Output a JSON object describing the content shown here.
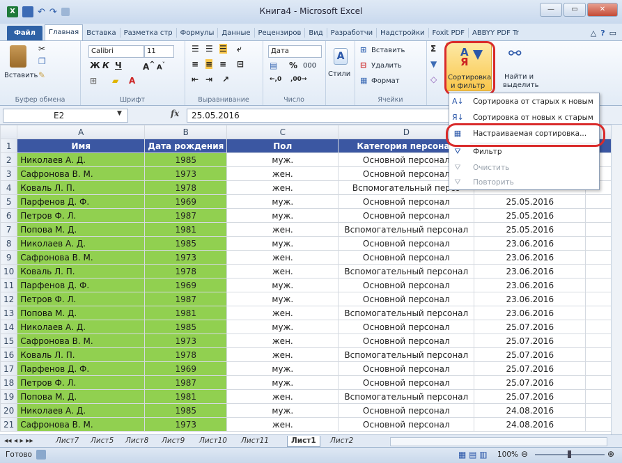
{
  "window": {
    "title": "Книга4 - Microsoft Excel"
  },
  "tabs": [
    "Файл",
    "Главная",
    "Вставка",
    "Разметка стр",
    "Формулы",
    "Данные",
    "Рецензиров",
    "Вид",
    "Разработчи",
    "Надстройки",
    "Foxit PDF",
    "ABBYY PDF Tr"
  ],
  "ribbon": {
    "paste": "Вставить",
    "clipboard_group": "Буфер обмена",
    "font_name": "Calibri",
    "font_size": "11",
    "bold": "Ж",
    "italic": "К",
    "underline": "Ч",
    "font_group": "Шрифт",
    "align_group": "Выравнивание",
    "number_format": "Дата",
    "percent": "%",
    "thousands": "000",
    "number_group": "Число",
    "styles": "Стили",
    "insert": "Вставить",
    "delete": "Удалить",
    "format": "Формат",
    "cells_group": "Ячейки",
    "sort_filter_line1": "Сортировка",
    "sort_filter_line2": "и фильтр",
    "find_line1": "Найти и",
    "find_line2": "выделить"
  },
  "formula_bar": {
    "name_box": "E2",
    "fx": "fx",
    "formula": "25.05.2016"
  },
  "columns": [
    "A",
    "B",
    "C",
    "D"
  ],
  "header_row": {
    "name": "Имя",
    "date": "Дата рождения",
    "sex": "Пол",
    "category": "Категория персонал"
  },
  "rows": [
    {
      "n": "2",
      "name": "Николаев А. Д.",
      "year": "1985",
      "sex": "муж.",
      "cat": "Основной персонал",
      "date": ""
    },
    {
      "n": "3",
      "name": "Сафронова В. М.",
      "year": "1973",
      "sex": "жен.",
      "cat": "Основной персонал",
      "date": ""
    },
    {
      "n": "4",
      "name": "Коваль Л. П.",
      "year": "1978",
      "sex": "жен.",
      "cat": "Вспомогательный персо",
      "date": ""
    },
    {
      "n": "5",
      "name": "Парфенов Д. Ф.",
      "year": "1969",
      "sex": "муж.",
      "cat": "Основной персонал",
      "date": "25.05.2016"
    },
    {
      "n": "6",
      "name": "Петров Ф. Л.",
      "year": "1987",
      "sex": "муж.",
      "cat": "Основной персонал",
      "date": "25.05.2016"
    },
    {
      "n": "7",
      "name": "Попова М. Д.",
      "year": "1981",
      "sex": "жен.",
      "cat": "Вспомогательный персонал",
      "date": "25.05.2016"
    },
    {
      "n": "8",
      "name": "Николаев А. Д.",
      "year": "1985",
      "sex": "муж.",
      "cat": "Основной персонал",
      "date": "23.06.2016"
    },
    {
      "n": "9",
      "name": "Сафронова В. М.",
      "year": "1973",
      "sex": "жен.",
      "cat": "Основной персонал",
      "date": "23.06.2016"
    },
    {
      "n": "10",
      "name": "Коваль Л. П.",
      "year": "1978",
      "sex": "жен.",
      "cat": "Вспомогательный персонал",
      "date": "23.06.2016"
    },
    {
      "n": "11",
      "name": "Парфенов Д. Ф.",
      "year": "1969",
      "sex": "муж.",
      "cat": "Основной персонал",
      "date": "23.06.2016"
    },
    {
      "n": "12",
      "name": "Петров Ф. Л.",
      "year": "1987",
      "sex": "муж.",
      "cat": "Основной персонал",
      "date": "23.06.2016"
    },
    {
      "n": "13",
      "name": "Попова М. Д.",
      "year": "1981",
      "sex": "жен.",
      "cat": "Вспомогательный персонал",
      "date": "23.06.2016"
    },
    {
      "n": "14",
      "name": "Николаев А. Д.",
      "year": "1985",
      "sex": "муж.",
      "cat": "Основной персонал",
      "date": "25.07.2016"
    },
    {
      "n": "15",
      "name": "Сафронова В. М.",
      "year": "1973",
      "sex": "жен.",
      "cat": "Основной персонал",
      "date": "25.07.2016"
    },
    {
      "n": "16",
      "name": "Коваль Л. П.",
      "year": "1978",
      "sex": "жен.",
      "cat": "Вспомогательный персонал",
      "date": "25.07.2016"
    },
    {
      "n": "17",
      "name": "Парфенов Д. Ф.",
      "year": "1969",
      "sex": "муж.",
      "cat": "Основной персонал",
      "date": "25.07.2016"
    },
    {
      "n": "18",
      "name": "Петров Ф. Л.",
      "year": "1987",
      "sex": "муж.",
      "cat": "Основной персонал",
      "date": "25.07.2016"
    },
    {
      "n": "19",
      "name": "Попова М. Д.",
      "year": "1981",
      "sex": "жен.",
      "cat": "Вспомогательный персонал",
      "date": "25.07.2016"
    },
    {
      "n": "20",
      "name": "Николаев А. Д.",
      "year": "1985",
      "sex": "муж.",
      "cat": "Основной персонал",
      "date": "24.08.2016"
    },
    {
      "n": "21",
      "name": "Сафронова В. М.",
      "year": "1973",
      "sex": "жен.",
      "cat": "Основной персонал",
      "date": "24.08.2016"
    }
  ],
  "menu": {
    "sort_asc": "Сортировка от старых к новым",
    "sort_desc": "Сортировка от новых к старым",
    "custom_sort": "Настраиваемая сортировка...",
    "filter": "Фильтр",
    "clear": "Очистить",
    "reapply": "Повторить"
  },
  "sheets": [
    "Лист7",
    "Лист5",
    "Лист8",
    "Лист9",
    "Лист10",
    "Лист11",
    "Лист1",
    "Лист2"
  ],
  "status": {
    "ready": "Готово",
    "zoom": "100%"
  },
  "colors": {
    "header_blue": "#3b57a2",
    "green": "#91d050",
    "highlight_red": "#d92b2b",
    "selected_button": "#f9c64a"
  }
}
